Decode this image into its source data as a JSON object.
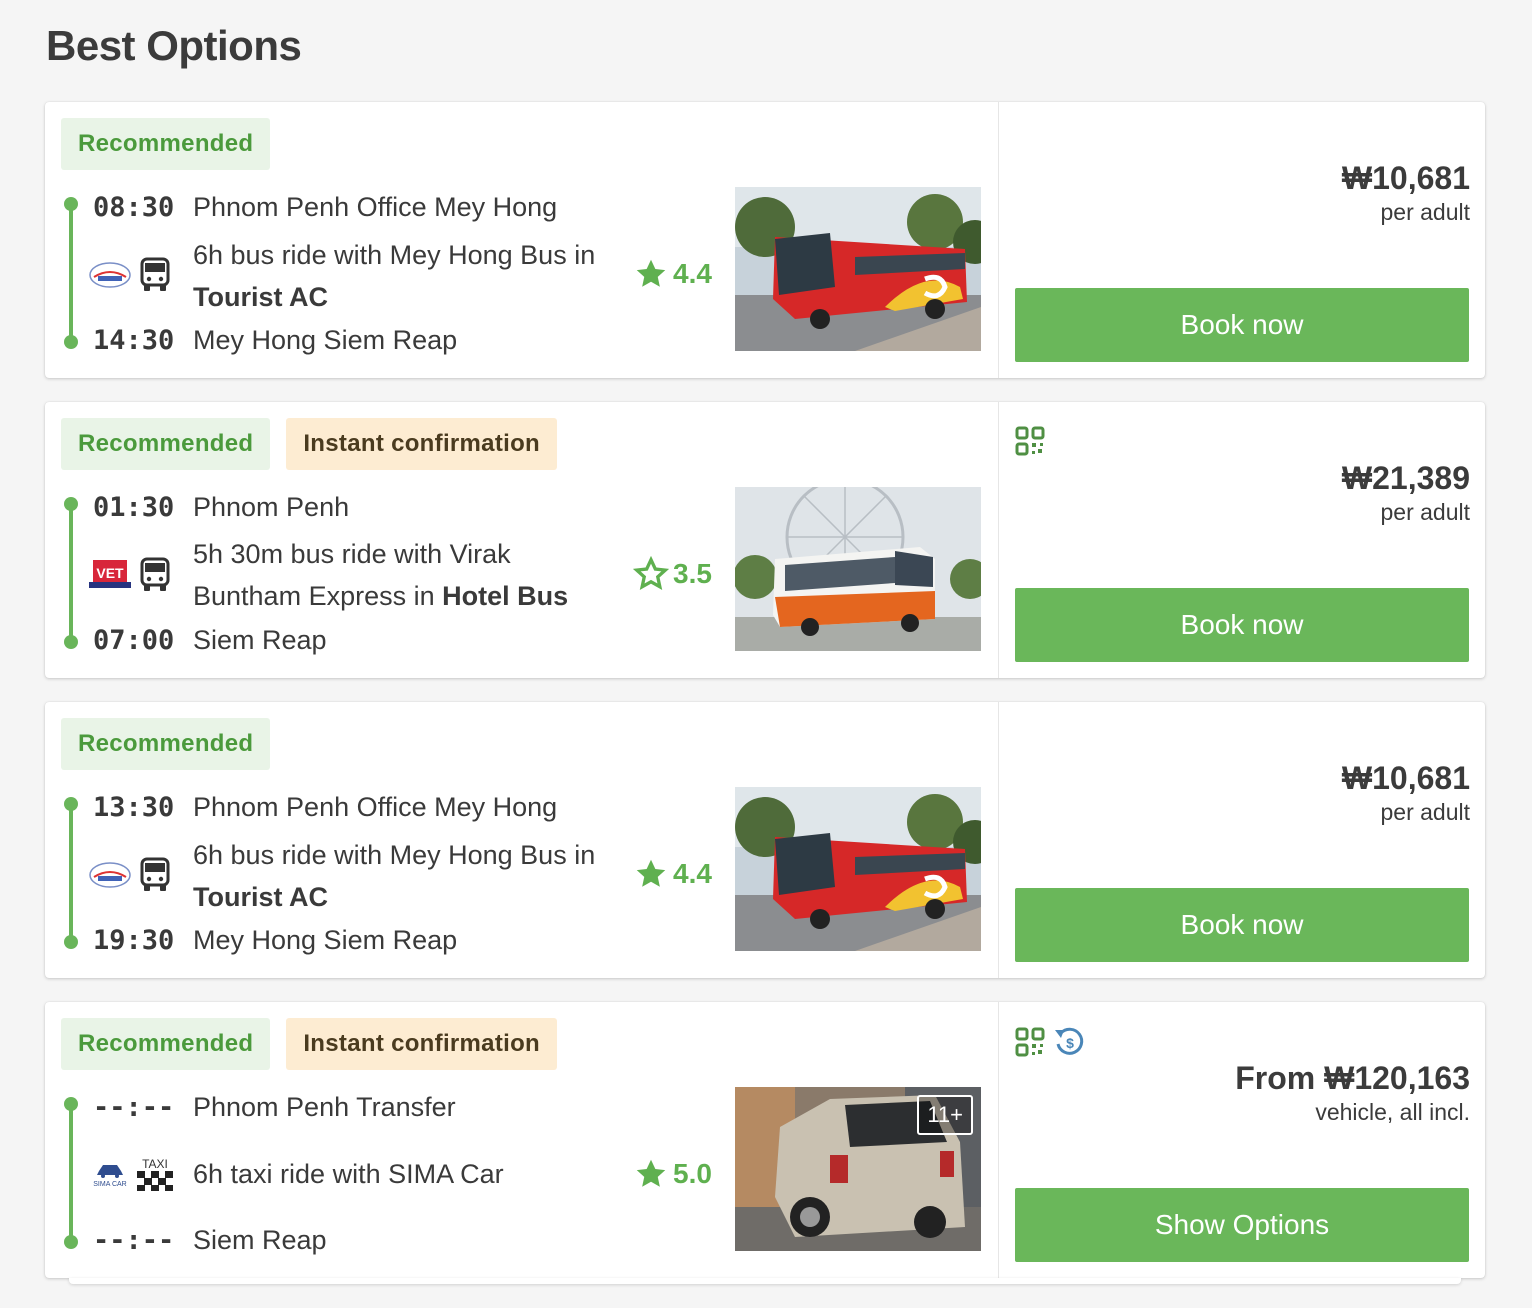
{
  "page": {
    "title": "Best Options"
  },
  "colors": {
    "accent": "#6ab75a",
    "recommended_bg": "#e9f4e7",
    "instant_bg": "#fdecd2",
    "star": "#5fb04f"
  },
  "options": [
    {
      "badges": [
        "Recommended"
      ],
      "depart_time": "08:30",
      "depart_place": "Phnom Penh Office Mey Hong",
      "ride_text": "6h bus ride with Mey Hong Bus in ",
      "ride_class": "Tourist AC",
      "arrive_time": "14:30",
      "arrive_place": "Mey Hong Siem Reap",
      "operator_logo": "mey-hong-logo",
      "vehicle_icon": "bus-icon",
      "rating": "4.4",
      "photo": "red-bus-photo",
      "price": "₩10,681",
      "price_unit": "per adult",
      "features": [],
      "action": "Book now"
    },
    {
      "badges": [
        "Recommended",
        "Instant confirmation"
      ],
      "depart_time": "01:30",
      "depart_place": "Phnom Penh",
      "ride_text": "5h 30m bus ride with Virak Buntham Express in ",
      "ride_class": "Hotel Bus",
      "arrive_time": "07:00",
      "arrive_place": "Siem Reap",
      "operator_logo": "virak-buntham-logo",
      "operator_logo_text": "VET",
      "vehicle_icon": "bus-icon",
      "rating": "3.5",
      "photo": "orange-bus-photo",
      "price": "₩21,389",
      "price_unit": "per adult",
      "features": [
        "qr-code-icon"
      ],
      "action": "Book now"
    },
    {
      "badges": [
        "Recommended"
      ],
      "depart_time": "13:30",
      "depart_place": "Phnom Penh Office Mey Hong",
      "ride_text": "6h bus ride with Mey Hong Bus in ",
      "ride_class": "Tourist AC",
      "arrive_time": "19:30",
      "arrive_place": "Mey Hong Siem Reap",
      "operator_logo": "mey-hong-logo",
      "vehicle_icon": "bus-icon",
      "rating": "4.4",
      "photo": "red-bus-photo",
      "price": "₩10,681",
      "price_unit": "per adult",
      "features": [],
      "action": "Book now"
    },
    {
      "badges": [
        "Recommended",
        "Instant confirmation"
      ],
      "depart_time": "--:--",
      "depart_place": "Phnom Penh Transfer",
      "ride_text": "6h taxi ride with SIMA Car",
      "ride_class": "",
      "arrive_time": "--:--",
      "arrive_place": "Siem Reap",
      "operator_logo": "sima-car-logo",
      "operator_logo_text": "SIMA CAR",
      "vehicle_icon": "taxi-icon",
      "vehicle_icon_text": "TAXI",
      "rating": "5.0",
      "photo": "silver-suv-photo",
      "photo_count": "11+",
      "price": "From ₩120,163",
      "price_unit": "vehicle, all incl.",
      "features": [
        "qr-code-icon",
        "refund-icon"
      ],
      "action": "Show Options"
    }
  ]
}
